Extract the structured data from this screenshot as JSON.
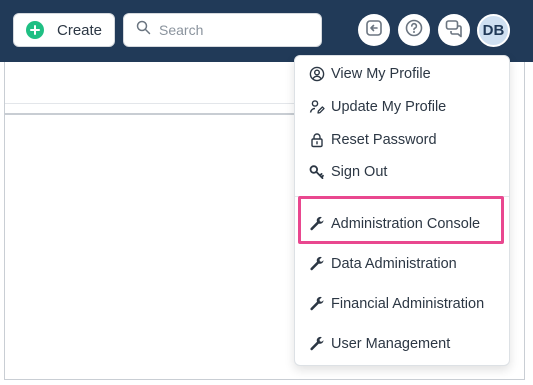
{
  "toolbar": {
    "create_label": "Create",
    "search_placeholder": "Search",
    "avatar_initials": "DB"
  },
  "user_menu": {
    "account_items": [
      {
        "label": "View My Profile",
        "icon": "user-circle-icon"
      },
      {
        "label": "Update My Profile",
        "icon": "user-edit-icon"
      },
      {
        "label": "Reset Password",
        "icon": "lock-icon"
      },
      {
        "label": "Sign Out",
        "icon": "key-icon"
      }
    ],
    "admin_items": [
      {
        "label": "Administration Console",
        "icon": "wrench-icon",
        "highlighted": true
      },
      {
        "label": "Data Administration",
        "icon": "wrench-icon"
      },
      {
        "label": "Financial Administration",
        "icon": "wrench-icon"
      },
      {
        "label": "User Management",
        "icon": "wrench-icon"
      }
    ]
  },
  "colors": {
    "topbar": "#213a58",
    "create_plus": "#1fbf83",
    "highlight_border": "#e9478f",
    "avatar_bg": "#cfe0f1"
  }
}
